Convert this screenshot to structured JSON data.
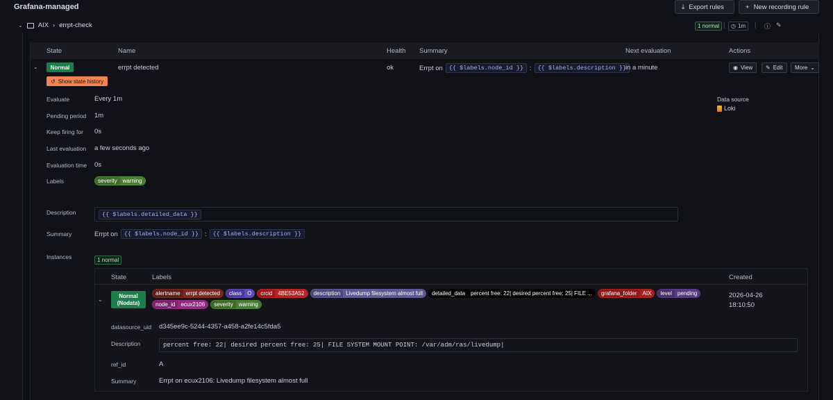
{
  "header": {
    "title": "Grafana-managed",
    "export_label": "Export rules",
    "new_recording_label": "New recording rule"
  },
  "group": {
    "folder": "AIX",
    "separator": "›",
    "name": "errpt-check",
    "count_badge": "1 normal",
    "interval": "1m"
  },
  "table": {
    "columns": [
      "State",
      "Name",
      "Health",
      "Summary",
      "Next evaluation",
      "Actions"
    ]
  },
  "rule": {
    "state": "Normal",
    "name": "errpt detected",
    "health": "ok",
    "summary_prefix": "Errpt on",
    "summary_code1": "{{ $labels.node_id }}",
    "summary_sep": ":",
    "summary_code2": "{{ $labels.description }}",
    "next_eval": "in a minute",
    "view_label": "View",
    "edit_label": "Edit",
    "more_label": "More",
    "history_label": "Show state history"
  },
  "details": {
    "evaluate_label": "Evaluate",
    "evaluate_value": "Every 1m",
    "pending_label": "Pending period",
    "pending_value": "1m",
    "keep_label": "Keep firing for",
    "keep_value": "0s",
    "last_label": "Last evaluation",
    "last_value": "a few seconds ago",
    "evaltime_label": "Evaluation time",
    "evaltime_value": "0s",
    "labels_label": "Labels",
    "label_key": "severity",
    "label_value": "warning",
    "datasource_label": "Data source",
    "datasource_value": "Loki",
    "description_label": "Description",
    "description_value": "{{ $labels.detailed_data }}",
    "summary_label": "Summary",
    "summary_prefix": "Errpt on",
    "summary_code1": "{{ $labels.node_id }}",
    "summary_sep": ":",
    "summary_code2": "{{ $labels.description }}",
    "instances_label": "Instances",
    "instances_badge": "1 normal"
  },
  "instances": {
    "columns": {
      "state": "State",
      "labels": "Labels",
      "created": "Created"
    },
    "row": {
      "state_line1": "Normal",
      "state_line2": "(Nodata)",
      "created_date": "2026-04-26",
      "created_time": "18:10:50",
      "labels": [
        {
          "k": "alertname",
          "v": "errpt detected",
          "kc": "#5c1f1a",
          "vc": "#7a2a22"
        },
        {
          "k": "class",
          "v": "O",
          "kc": "#4b3a9a",
          "vc": "#5d4bb8"
        },
        {
          "k": "crcid",
          "v": "4BE53A52",
          "kc": "#9a1c1c",
          "vc": "#b52525"
        },
        {
          "k": "description",
          "v": "Livedump filesystem almost full",
          "kc": "#4e4a7e",
          "vc": "#5f5a96"
        },
        {
          "k": "detailed_data",
          "v": "percent free: 22| desired percent free: 25| FILE ...",
          "kc": "#000000",
          "vc": "#000000"
        },
        {
          "k": "grafana_folder",
          "v": "AIX",
          "kc": "#8d1b1b",
          "vc": "#a82121"
        },
        {
          "k": "level",
          "v": "pending",
          "kc": "#4a2f6e",
          "vc": "#5a3985"
        },
        {
          "k": "node_id",
          "v": "ecux2106",
          "kc": "#7a236e",
          "vc": "#922b84"
        },
        {
          "k": "severity",
          "v": "warning",
          "kc": "#3d6b2a",
          "vc": "#4a7f33"
        }
      ],
      "datasource_uid_label": "datasource_uid",
      "datasource_uid_value": "d345ee9c-5244-4357-a458-a2fe14c5fda5",
      "description_label": "Description",
      "description_value": "percent free: 22| desired percent free: 25| FILE SYSTEM MOUNT POINT: /var/adm/ras/livedump|",
      "refid_label": "ref_id",
      "refid_value": "A",
      "summary_label": "Summary",
      "summary_value": "Errpt on ecux2106: Livedump filesystem almost full"
    }
  }
}
